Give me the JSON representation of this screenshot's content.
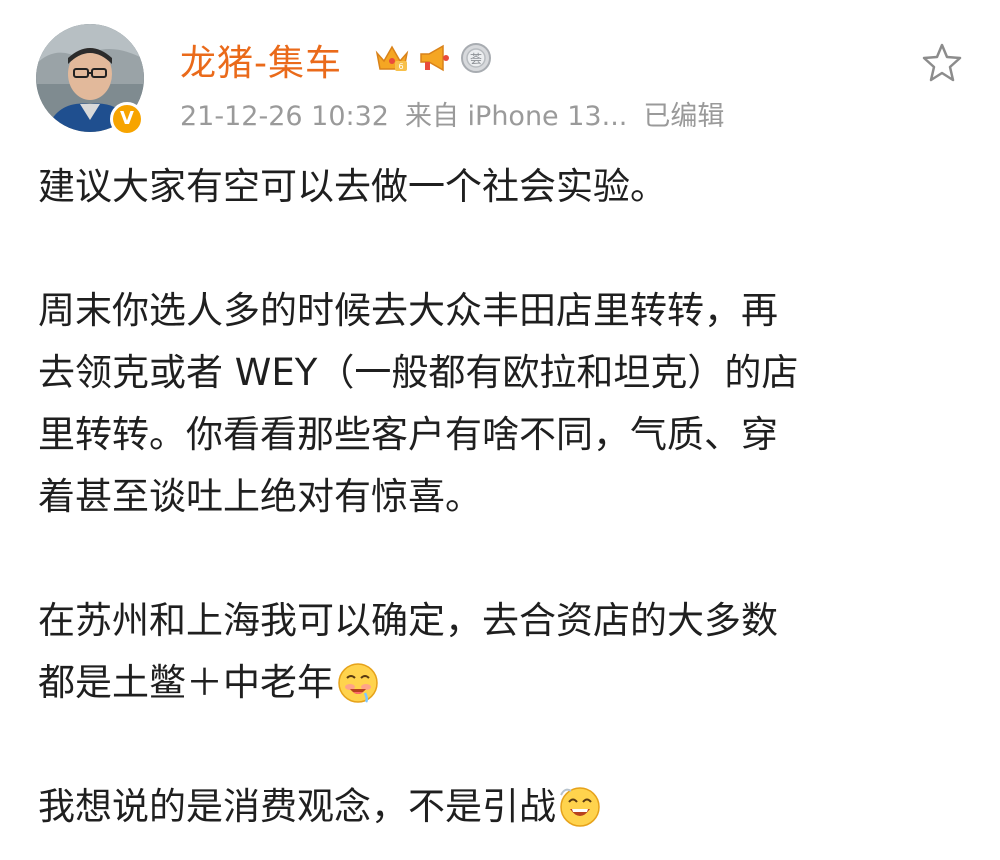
{
  "post": {
    "author": "龙猪-集车",
    "timestamp": "21-12-26 10:32",
    "source": "来自 iPhone 13...",
    "edited": "已编辑"
  },
  "badges": [
    "crown-vip-icon",
    "megaphone-icon",
    "medal-icon"
  ],
  "content": {
    "p1": "建议大家有空可以去做一个社会实验。",
    "p2_l1": "周末你选人多的时候去大众丰田店里转转，再",
    "p2_l2": "去领克或者 WEY（一般都有欧拉和坦克）的店",
    "p2_l3": "里转转。你看看那些客户有啥不同，气质、穿",
    "p2_l4": "着甚至谈吐上绝对有惊喜。",
    "p3_l1": "在苏州和上海我可以确定，去合资店的大多数",
    "p3_l2": "都是土鳖＋中老年",
    "p4": "我想说的是消费观念，不是引战"
  },
  "colors": {
    "username": "#ea6a1a",
    "meta": "#9a9a9a",
    "text": "#1f1f1f",
    "verified_badge": "#f7a400"
  }
}
